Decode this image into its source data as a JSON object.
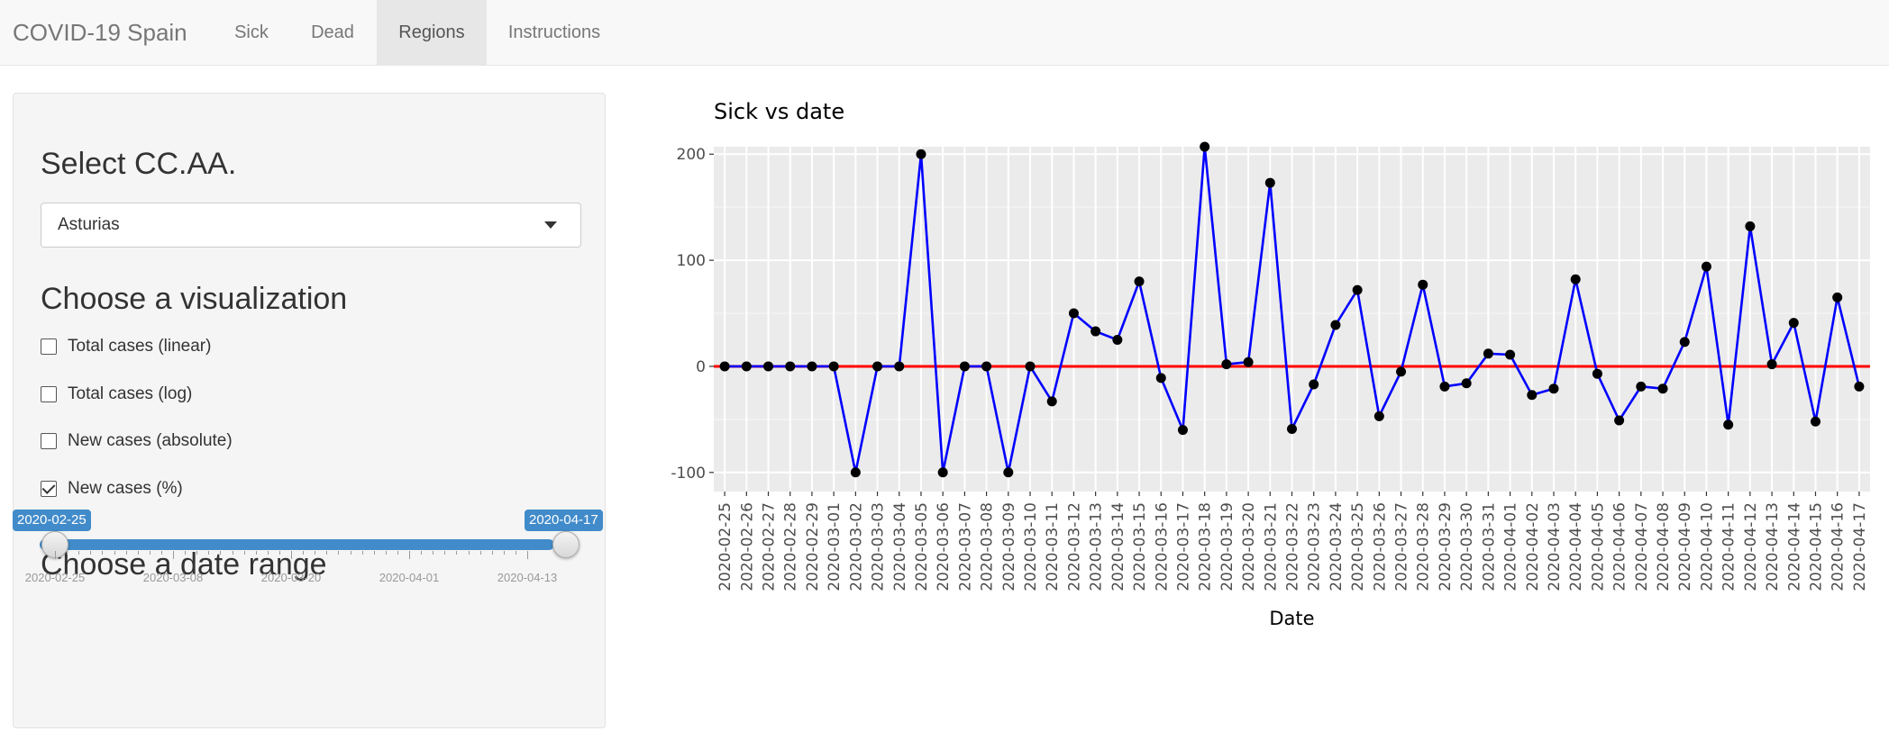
{
  "navbar": {
    "brand": "COVID-19 Spain",
    "tabs": [
      {
        "label": "Sick",
        "active": false
      },
      {
        "label": "Dead",
        "active": false
      },
      {
        "label": "Regions",
        "active": true
      },
      {
        "label": "Instructions",
        "active": false
      }
    ]
  },
  "sidebar": {
    "region_heading": "Select CC.AA.",
    "region_selected": "Asturias",
    "viz_heading": "Choose a visualization",
    "checkboxes": [
      {
        "label": "Total cases (linear)",
        "checked": false
      },
      {
        "label": "Total cases (log)",
        "checked": false
      },
      {
        "label": "New cases (absolute)",
        "checked": false
      },
      {
        "label": "New cases (%)",
        "checked": true
      }
    ],
    "date_heading": "Choose a date range",
    "slider": {
      "from": "2020-02-25",
      "to": "2020-04-17",
      "grid_labels": [
        "2020-02-25",
        "2020-03-08",
        "2020-03-20",
        "2020-04-01",
        "2020-04-13"
      ]
    }
  },
  "colors": {
    "accent": "#428bca",
    "line": "#0000ff",
    "zero_line": "#ff0000",
    "panel_bg": "#ebebeb"
  },
  "chart_data": {
    "type": "line",
    "title": "Sick vs date",
    "xlabel": "Date",
    "ylabel": "",
    "ylim": [
      -118,
      207
    ],
    "yticks": [
      200,
      100,
      0,
      -100
    ],
    "x": [
      "2020-02-25",
      "2020-02-26",
      "2020-02-27",
      "2020-02-28",
      "2020-02-29",
      "2020-03-01",
      "2020-03-02",
      "2020-03-03",
      "2020-03-04",
      "2020-03-05",
      "2020-03-06",
      "2020-03-07",
      "2020-03-08",
      "2020-03-09",
      "2020-03-10",
      "2020-03-11",
      "2020-03-12",
      "2020-03-13",
      "2020-03-14",
      "2020-03-15",
      "2020-03-16",
      "2020-03-17",
      "2020-03-18",
      "2020-03-19",
      "2020-03-20",
      "2020-03-21",
      "2020-03-22",
      "2020-03-23",
      "2020-03-24",
      "2020-03-25",
      "2020-03-26",
      "2020-03-27",
      "2020-03-28",
      "2020-03-29",
      "2020-03-30",
      "2020-03-31",
      "2020-04-01",
      "2020-04-02",
      "2020-04-03",
      "2020-04-04",
      "2020-04-05",
      "2020-04-06",
      "2020-04-07",
      "2020-04-08",
      "2020-04-09",
      "2020-04-10",
      "2020-04-11",
      "2020-04-12",
      "2020-04-13",
      "2020-04-14",
      "2020-04-15",
      "2020-04-16",
      "2020-04-17"
    ],
    "series": [
      {
        "values": [
          0,
          0,
          0,
          0,
          0,
          0,
          -100,
          0,
          0,
          200,
          -100,
          0,
          0,
          -100,
          0,
          -33,
          50,
          33,
          25,
          80,
          -11,
          -60,
          207,
          2,
          4,
          173,
          -59,
          -17,
          39,
          72,
          -47,
          -5,
          77,
          -19,
          -16,
          12,
          11,
          -27,
          -21,
          82,
          -7,
          -51,
          -19,
          -21,
          23,
          94,
          -55,
          132,
          2,
          41,
          -52,
          65,
          -19
        ]
      }
    ],
    "hlines": [
      0
    ],
    "grid": true
  }
}
